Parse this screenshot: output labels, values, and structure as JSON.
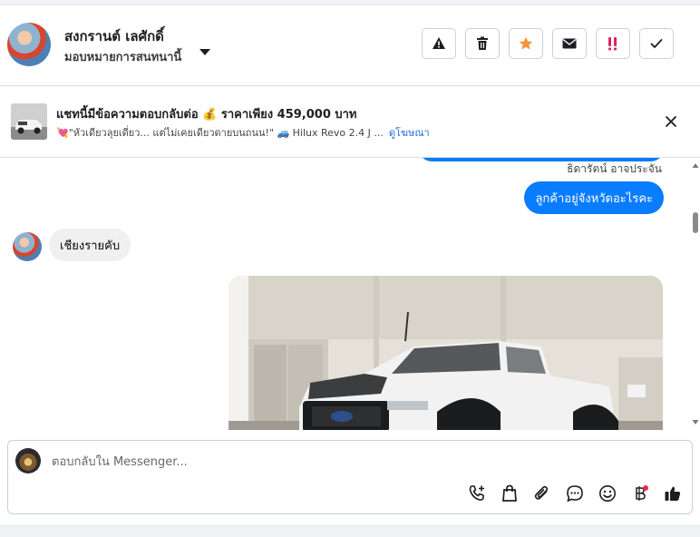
{
  "header": {
    "contact_name": "สงกรานต์ เลศักดิ์",
    "assignment": "มอบหมายการสนทนานี้",
    "actions": [
      {
        "name": "report-icon",
        "symbol": "!"
      },
      {
        "name": "trash-icon"
      },
      {
        "name": "star-icon",
        "color": "#f7923a"
      },
      {
        "name": "envelope-icon"
      },
      {
        "name": "priority-icon",
        "color": "#e0245e"
      },
      {
        "name": "check-icon"
      }
    ]
  },
  "ad_banner": {
    "title": "แชทนี้มีข้อความตอบกลับต่อ 💰 ราคาเพียง 459,000 บาท",
    "subtitle": "💘\"หัวเดียวลุยเดี่ยว... แต่ไม่เคยเดียวดายบนถนน!\" 🚙 Hilux Revo 2.4 J ...",
    "link": "ดูโฆษณา"
  },
  "chat": {
    "messages": [
      {
        "direction": "outgoing",
        "sender": "ธิดารัตน์ อาจประจัน",
        "text": "ลูกค้าอยู่จังหวัดอะไรคะ"
      },
      {
        "direction": "incoming",
        "text": "เชียงรายคับ"
      },
      {
        "direction": "outgoing",
        "type": "image"
      }
    ],
    "accent": "#0a7cff"
  },
  "composer": {
    "placeholder": "ตอบกลับใน Messenger...",
    "icons": [
      "phone-plus-icon",
      "shopping-bag-icon",
      "paperclip-icon",
      "chat-bubble-icon",
      "smiley-icon",
      "baht-icon",
      "thumbs-up-icon"
    ],
    "notification_dot": "#f02849"
  }
}
